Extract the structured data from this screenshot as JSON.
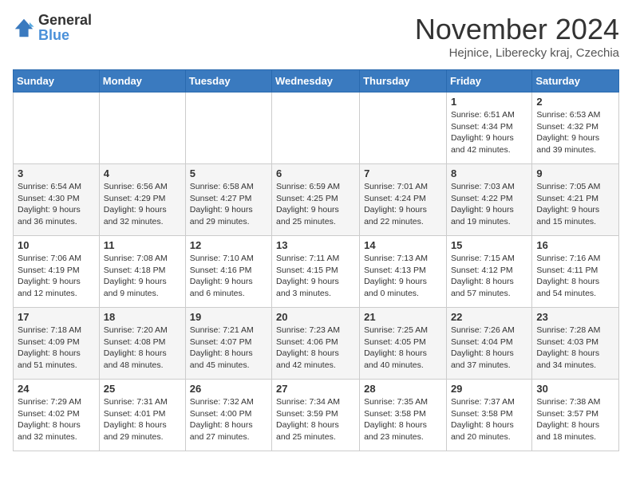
{
  "logo": {
    "text1": "General",
    "text2": "Blue"
  },
  "header": {
    "month": "November 2024",
    "location": "Hejnice, Liberecky kraj, Czechia"
  },
  "weekdays": [
    "Sunday",
    "Monday",
    "Tuesday",
    "Wednesday",
    "Thursday",
    "Friday",
    "Saturday"
  ],
  "weeks": [
    [
      {
        "day": "",
        "info": ""
      },
      {
        "day": "",
        "info": ""
      },
      {
        "day": "",
        "info": ""
      },
      {
        "day": "",
        "info": ""
      },
      {
        "day": "",
        "info": ""
      },
      {
        "day": "1",
        "info": "Sunrise: 6:51 AM\nSunset: 4:34 PM\nDaylight: 9 hours and 42 minutes."
      },
      {
        "day": "2",
        "info": "Sunrise: 6:53 AM\nSunset: 4:32 PM\nDaylight: 9 hours and 39 minutes."
      }
    ],
    [
      {
        "day": "3",
        "info": "Sunrise: 6:54 AM\nSunset: 4:30 PM\nDaylight: 9 hours and 36 minutes."
      },
      {
        "day": "4",
        "info": "Sunrise: 6:56 AM\nSunset: 4:29 PM\nDaylight: 9 hours and 32 minutes."
      },
      {
        "day": "5",
        "info": "Sunrise: 6:58 AM\nSunset: 4:27 PM\nDaylight: 9 hours and 29 minutes."
      },
      {
        "day": "6",
        "info": "Sunrise: 6:59 AM\nSunset: 4:25 PM\nDaylight: 9 hours and 25 minutes."
      },
      {
        "day": "7",
        "info": "Sunrise: 7:01 AM\nSunset: 4:24 PM\nDaylight: 9 hours and 22 minutes."
      },
      {
        "day": "8",
        "info": "Sunrise: 7:03 AM\nSunset: 4:22 PM\nDaylight: 9 hours and 19 minutes."
      },
      {
        "day": "9",
        "info": "Sunrise: 7:05 AM\nSunset: 4:21 PM\nDaylight: 9 hours and 15 minutes."
      }
    ],
    [
      {
        "day": "10",
        "info": "Sunrise: 7:06 AM\nSunset: 4:19 PM\nDaylight: 9 hours and 12 minutes."
      },
      {
        "day": "11",
        "info": "Sunrise: 7:08 AM\nSunset: 4:18 PM\nDaylight: 9 hours and 9 minutes."
      },
      {
        "day": "12",
        "info": "Sunrise: 7:10 AM\nSunset: 4:16 PM\nDaylight: 9 hours and 6 minutes."
      },
      {
        "day": "13",
        "info": "Sunrise: 7:11 AM\nSunset: 4:15 PM\nDaylight: 9 hours and 3 minutes."
      },
      {
        "day": "14",
        "info": "Sunrise: 7:13 AM\nSunset: 4:13 PM\nDaylight: 9 hours and 0 minutes."
      },
      {
        "day": "15",
        "info": "Sunrise: 7:15 AM\nSunset: 4:12 PM\nDaylight: 8 hours and 57 minutes."
      },
      {
        "day": "16",
        "info": "Sunrise: 7:16 AM\nSunset: 4:11 PM\nDaylight: 8 hours and 54 minutes."
      }
    ],
    [
      {
        "day": "17",
        "info": "Sunrise: 7:18 AM\nSunset: 4:09 PM\nDaylight: 8 hours and 51 minutes."
      },
      {
        "day": "18",
        "info": "Sunrise: 7:20 AM\nSunset: 4:08 PM\nDaylight: 8 hours and 48 minutes."
      },
      {
        "day": "19",
        "info": "Sunrise: 7:21 AM\nSunset: 4:07 PM\nDaylight: 8 hours and 45 minutes."
      },
      {
        "day": "20",
        "info": "Sunrise: 7:23 AM\nSunset: 4:06 PM\nDaylight: 8 hours and 42 minutes."
      },
      {
        "day": "21",
        "info": "Sunrise: 7:25 AM\nSunset: 4:05 PM\nDaylight: 8 hours and 40 minutes."
      },
      {
        "day": "22",
        "info": "Sunrise: 7:26 AM\nSunset: 4:04 PM\nDaylight: 8 hours and 37 minutes."
      },
      {
        "day": "23",
        "info": "Sunrise: 7:28 AM\nSunset: 4:03 PM\nDaylight: 8 hours and 34 minutes."
      }
    ],
    [
      {
        "day": "24",
        "info": "Sunrise: 7:29 AM\nSunset: 4:02 PM\nDaylight: 8 hours and 32 minutes."
      },
      {
        "day": "25",
        "info": "Sunrise: 7:31 AM\nSunset: 4:01 PM\nDaylight: 8 hours and 29 minutes."
      },
      {
        "day": "26",
        "info": "Sunrise: 7:32 AM\nSunset: 4:00 PM\nDaylight: 8 hours and 27 minutes."
      },
      {
        "day": "27",
        "info": "Sunrise: 7:34 AM\nSunset: 3:59 PM\nDaylight: 8 hours and 25 minutes."
      },
      {
        "day": "28",
        "info": "Sunrise: 7:35 AM\nSunset: 3:58 PM\nDaylight: 8 hours and 23 minutes."
      },
      {
        "day": "29",
        "info": "Sunrise: 7:37 AM\nSunset: 3:58 PM\nDaylight: 8 hours and 20 minutes."
      },
      {
        "day": "30",
        "info": "Sunrise: 7:38 AM\nSunset: 3:57 PM\nDaylight: 8 hours and 18 minutes."
      }
    ]
  ]
}
